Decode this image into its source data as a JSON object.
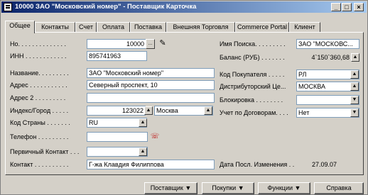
{
  "window": {
    "title": "10000 ЗАО \"Московский номер\" - Поставщик Карточка",
    "min": "_",
    "max": "□",
    "close": "×"
  },
  "tabs": [
    "Общее",
    "Контакты",
    "Счет",
    "Оплата",
    "Поставка",
    "Внешняя Торговля",
    "Commerce Portal",
    "Клиент"
  ],
  "left": {
    "no_label": "Но. . . . . . . . . . . . . .",
    "no_value": "10000",
    "inn_label": "ИНН . . . . . . . . . . . .",
    "inn_value": "895741963",
    "name_label": "Название. . . . . . . . .",
    "name_value": "ЗАО \"Московский номер\"",
    "address_label": "Адрес . . . . . . . . . . .",
    "address_value": "Северный проспект, 10",
    "address2_label": "Адрес 2 . . . . . . . . .",
    "address2_value": "",
    "index_label": "Индекс/Город . . . . .",
    "index_value": "123022",
    "city_value": "Москва",
    "country_label": "Код Страны . . . . . . .",
    "country_value": "RU",
    "phone_label": "Телефон . . . . . . . . .",
    "phone_value": "",
    "primary_contact_label": "Первичный Контакт . . .",
    "primary_contact_value": "",
    "contact_label": "Контакт . . . . . . . . . .",
    "contact_value": "Г-жа Клавдия Филиппова"
  },
  "right": {
    "search_name_label": "Имя Поиска. . . . . . . . .",
    "search_name_value": "ЗАО \"МОСКОВС...",
    "balance_label": "Баланс (РУБ) . . . . . . .",
    "balance_value": "4`150`360,68",
    "buyer_code_label": "Код Покупателя . . . . .",
    "buyer_code_value": "РЛ",
    "distributor_label": "Дистрибуторский Це...",
    "distributor_value": "МОСКВА",
    "block_label": "Блокировка . . . . . . . .",
    "block_value": "",
    "contract_label": "Учет по Договорам. . . .",
    "contract_value": "Нет",
    "last_modified_label": "Дата Посл. Изменения . .",
    "last_modified_value": "27.09.07"
  },
  "buttons": {
    "supplier": "Поставщик",
    "purchases": "Покупки",
    "functions": "Функции",
    "help": "Справка"
  }
}
